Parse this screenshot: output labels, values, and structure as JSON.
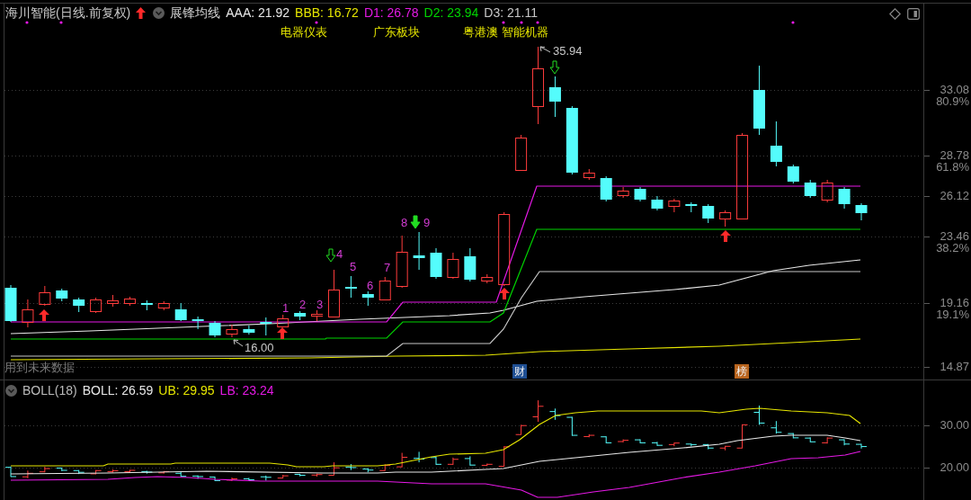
{
  "header": {
    "title": "海川智能(日线.前复权)",
    "indicator": "展锋均线",
    "readings": [
      {
        "label": "AAA: 21.92",
        "color": "#e8e8e8"
      },
      {
        "label": "BBB: 16.72",
        "color": "#e6e600"
      },
      {
        "label": "D1: 26.78",
        "color": "#e619e6"
      },
      {
        "label": "D2: 23.94",
        "color": "#00d400"
      },
      {
        "label": "D3: 21.11",
        "color": "#c8c8c8"
      }
    ]
  },
  "sector_labels": [
    "电器仪表",
    "广东板块",
    "粤港澳 智能机器"
  ],
  "price_markers": {
    "high": "35.94",
    "low": "16.00"
  },
  "count_labels": [
    "1",
    "2",
    "3",
    "4",
    "5",
    "6",
    "7",
    "8",
    "9"
  ],
  "note": "用到未来数据",
  "event_tags": [
    {
      "text": "财",
      "color": "#1f4f93"
    },
    {
      "text": "榜",
      "color": "#b8641e"
    }
  ],
  "price_axis": [
    {
      "price": "33.08",
      "ratio": "80.9%"
    },
    {
      "price": "28.78",
      "ratio": "61.8%"
    },
    {
      "price": "26.12"
    },
    {
      "price": "23.46",
      "ratio": "38.2%"
    },
    {
      "price": "19.16",
      "ratio": "19.1%"
    },
    {
      "price": "14.87"
    }
  ],
  "boll": {
    "title": "BOLL(18)",
    "readings": [
      {
        "label": "BOLL: 26.59",
        "color": "#e8e8e8"
      },
      {
        "label": "UB: 29.95",
        "color": "#e6e600"
      },
      {
        "label": "LB: 23.24",
        "color": "#e619e6"
      }
    ],
    "axis": [
      "30.00",
      "20.00"
    ]
  }
}
